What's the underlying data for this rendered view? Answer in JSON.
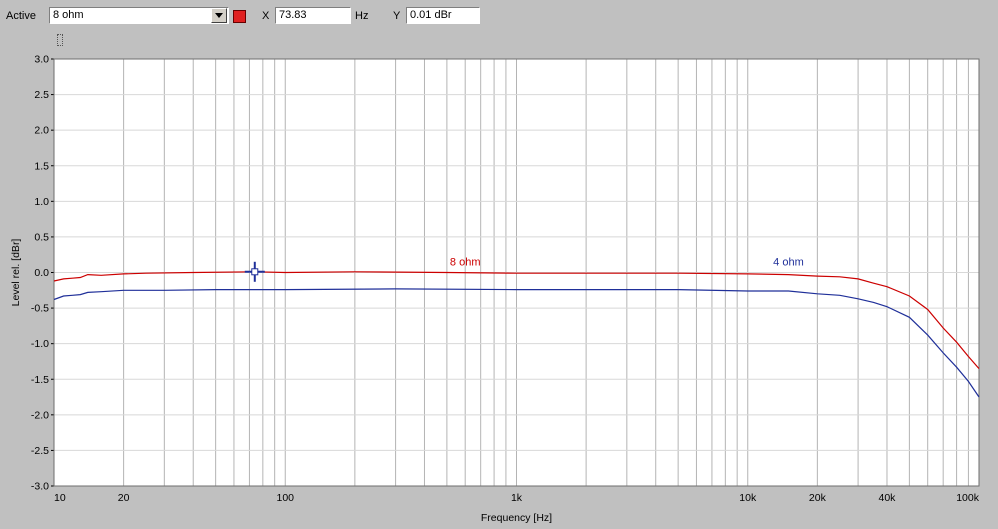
{
  "toolbar": {
    "active_label": "Active",
    "active_value": "8 ohm",
    "active_color": "#e02020",
    "x_label": "X",
    "x_value": "73.83",
    "x_unit": "Hz",
    "y_label": "Y",
    "y_value": "0.01 dBr"
  },
  "icons": {
    "pin": "pin-icon",
    "dropdown": "chevron-down-icon",
    "cursor": "crosshair-cursor-icon"
  },
  "chart_data": {
    "type": "line",
    "title": "",
    "xlabel": "Frequency [Hz]",
    "ylabel": "Level rel. [dBr]",
    "xscale": "log",
    "xlim": [
      10,
      100000
    ],
    "ylim": [
      -3.0,
      3.0
    ],
    "grid": true,
    "x_ticks": [
      {
        "value": 10,
        "label": "10"
      },
      {
        "value": 20,
        "label": "20"
      },
      {
        "value": 100,
        "label": "100"
      },
      {
        "value": 1000,
        "label": "1k"
      },
      {
        "value": 10000,
        "label": "10k"
      },
      {
        "value": 20000,
        "label": "20k"
      },
      {
        "value": 40000,
        "label": "40k"
      },
      {
        "value": 100000,
        "label": "100k"
      }
    ],
    "y_ticks": [
      {
        "value": 3.0,
        "label": "3.0"
      },
      {
        "value": 2.5,
        "label": "2.5"
      },
      {
        "value": 2.0,
        "label": "2.0"
      },
      {
        "value": 1.5,
        "label": "1.5"
      },
      {
        "value": 1.0,
        "label": "1.0"
      },
      {
        "value": 0.5,
        "label": "0.5"
      },
      {
        "value": 0.0,
        "label": "0.0"
      },
      {
        "value": -0.5,
        "label": "-0.5"
      },
      {
        "value": -1.0,
        "label": "-1.0"
      },
      {
        "value": -1.5,
        "label": "-1.5"
      },
      {
        "value": -2.0,
        "label": "-2.0"
      },
      {
        "value": -2.5,
        "label": "-2.5"
      },
      {
        "value": -3.0,
        "label": "-3.0"
      }
    ],
    "series": [
      {
        "name": "8 ohm",
        "color": "#cc0000",
        "label_at": {
          "x": 600,
          "y": 0.1
        },
        "points": [
          [
            10,
            -0.12
          ],
          [
            11,
            -0.09
          ],
          [
            12,
            -0.08
          ],
          [
            13,
            -0.07
          ],
          [
            14,
            -0.03
          ],
          [
            16,
            -0.04
          ],
          [
            20,
            -0.02
          ],
          [
            25,
            -0.01
          ],
          [
            40,
            0.0
          ],
          [
            73.83,
            0.01
          ],
          [
            100,
            0.0
          ],
          [
            200,
            0.01
          ],
          [
            500,
            0.0
          ],
          [
            1000,
            -0.01
          ],
          [
            2000,
            -0.01
          ],
          [
            5000,
            -0.01
          ],
          [
            10000,
            -0.02
          ],
          [
            15000,
            -0.03
          ],
          [
            20000,
            -0.05
          ],
          [
            25000,
            -0.06
          ],
          [
            30000,
            -0.09
          ],
          [
            35000,
            -0.15
          ],
          [
            40000,
            -0.2
          ],
          [
            50000,
            -0.33
          ],
          [
            60000,
            -0.52
          ],
          [
            70000,
            -0.78
          ],
          [
            80000,
            -0.98
          ],
          [
            90000,
            -1.18
          ],
          [
            100000,
            -1.35
          ]
        ]
      },
      {
        "name": "4 ohm",
        "color": "#1f2f99",
        "label_at": {
          "x": 15000,
          "y": 0.1
        },
        "points": [
          [
            10,
            -0.38
          ],
          [
            11,
            -0.33
          ],
          [
            12,
            -0.32
          ],
          [
            13,
            -0.31
          ],
          [
            14,
            -0.28
          ],
          [
            16,
            -0.27
          ],
          [
            20,
            -0.25
          ],
          [
            30,
            -0.25
          ],
          [
            50,
            -0.24
          ],
          [
            100,
            -0.24
          ],
          [
            300,
            -0.23
          ],
          [
            1000,
            -0.24
          ],
          [
            3000,
            -0.24
          ],
          [
            5000,
            -0.24
          ],
          [
            10000,
            -0.26
          ],
          [
            15000,
            -0.26
          ],
          [
            20000,
            -0.3
          ],
          [
            25000,
            -0.32
          ],
          [
            30000,
            -0.37
          ],
          [
            35000,
            -0.42
          ],
          [
            40000,
            -0.48
          ],
          [
            50000,
            -0.63
          ],
          [
            60000,
            -0.88
          ],
          [
            70000,
            -1.13
          ],
          [
            80000,
            -1.33
          ],
          [
            90000,
            -1.53
          ],
          [
            100000,
            -1.75
          ]
        ]
      }
    ],
    "cursor": {
      "x": 73.83,
      "y": 0.01
    }
  }
}
